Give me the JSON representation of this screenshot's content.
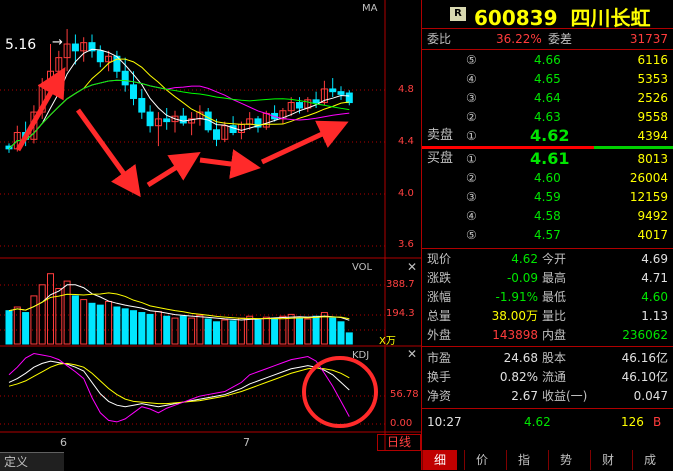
{
  "chart": {
    "indicator_ma": "MA",
    "price_label": "5.16",
    "price_axis": [
      "4.8",
      "4.4",
      "4.0",
      "3.6"
    ],
    "vol_title": "VOL",
    "vol_axis": [
      "388.7",
      "194.3"
    ],
    "vol_unit": "X万",
    "kdj_title": "KDJ",
    "kdj_axis": [
      "56.78",
      "0.00"
    ],
    "x_labels": [
      "6",
      "7"
    ],
    "period_tab": "日线",
    "left_tab": "定义"
  },
  "colors": {
    "up": "#ff3c3c",
    "down": "#00e6ff",
    "grid": "#b00000",
    "ma5": "#ffffff",
    "ma10": "#ffff00",
    "ma20": "#ff00ff",
    "ma30": "#00ff00",
    "annotation": "#ff2a2a"
  },
  "quote": {
    "code": "600839",
    "name": "四川长虹",
    "badge": "R",
    "weibi_label": "委比",
    "weibi_value": "36.22%",
    "weicha_label": "委差",
    "weicha_value": "31737",
    "asks": [
      {
        "label": "⑤",
        "price": "4.66",
        "volume": "6116"
      },
      {
        "label": "④",
        "price": "4.65",
        "volume": "5353"
      },
      {
        "label": "③",
        "price": "4.64",
        "volume": "2526"
      },
      {
        "label": "②",
        "price": "4.63",
        "volume": "9558"
      },
      {
        "label": "①",
        "price": "4.62",
        "volume": "4394"
      }
    ],
    "ask_section": "卖盘",
    "bid_section": "买盘",
    "bids": [
      {
        "label": "①",
        "price": "4.61",
        "volume": "8013"
      },
      {
        "label": "②",
        "price": "4.60",
        "volume": "26004"
      },
      {
        "label": "③",
        "price": "4.59",
        "volume": "12159"
      },
      {
        "label": "④",
        "price": "4.58",
        "volume": "9492"
      },
      {
        "label": "⑤",
        "price": "4.57",
        "volume": "4017"
      }
    ],
    "stats": [
      {
        "l1": "现价",
        "v1": "4.62",
        "l2": "今开",
        "v2": "4.69"
      },
      {
        "l1": "涨跌",
        "v1": "-0.09",
        "l2": "最高",
        "v2": "4.71"
      },
      {
        "l1": "涨幅",
        "v1": "-1.91%",
        "l2": "最低",
        "v2": "4.60"
      },
      {
        "l1": "总量",
        "v1": "38.00万",
        "l2": "量比",
        "v2": "1.13"
      },
      {
        "l1": "外盘",
        "v1": "143898",
        "l2": "内盘",
        "v2": "236062"
      }
    ],
    "fund": [
      {
        "l1": "市盈",
        "v1": "24.68",
        "l2": "股本",
        "v2": "46.16亿"
      },
      {
        "l1": "换手",
        "v1": "0.82%",
        "l2": "流通",
        "v2": "46.10亿"
      },
      {
        "l1": "净资",
        "v1": "2.67",
        "l2": "收益(一)",
        "v2": "0.047"
      }
    ],
    "tick": {
      "time": "10:27",
      "price": "4.62",
      "volume": "126",
      "side": "B"
    },
    "tabs": [
      "细",
      "价",
      "指",
      "势",
      "财",
      "成"
    ]
  },
  "chart_data": {
    "type": "candlestick",
    "price_ylim": [
      3.5,
      5.3
    ],
    "candles": [
      [
        4.3,
        4.32,
        4.25,
        4.28
      ],
      [
        4.28,
        4.45,
        4.26,
        4.4
      ],
      [
        4.4,
        4.48,
        4.3,
        4.35
      ],
      [
        4.35,
        4.6,
        4.32,
        4.55
      ],
      [
        4.55,
        4.8,
        4.5,
        4.75
      ],
      [
        4.75,
        5.05,
        4.7,
        4.85
      ],
      [
        4.85,
        5.0,
        4.78,
        4.95
      ],
      [
        4.95,
        5.16,
        4.85,
        5.05
      ],
      [
        5.05,
        5.12,
        4.9,
        5.0
      ],
      [
        5.0,
        5.1,
        4.92,
        5.06
      ],
      [
        5.06,
        5.12,
        4.95,
        5.0
      ],
      [
        5.0,
        5.04,
        4.88,
        4.92
      ],
      [
        4.92,
        5.0,
        4.85,
        4.96
      ],
      [
        4.96,
        5.0,
        4.8,
        4.85
      ],
      [
        4.85,
        4.95,
        4.7,
        4.75
      ],
      [
        4.75,
        4.85,
        4.6,
        4.65
      ],
      [
        4.65,
        4.72,
        4.5,
        4.55
      ],
      [
        4.55,
        4.6,
        4.4,
        4.45
      ],
      [
        4.45,
        4.55,
        4.3,
        4.5
      ],
      [
        4.5,
        4.58,
        4.42,
        4.48
      ],
      [
        4.48,
        4.56,
        4.4,
        4.52
      ],
      [
        4.52,
        4.58,
        4.45,
        4.47
      ],
      [
        4.47,
        4.55,
        4.38,
        4.5
      ],
      [
        4.5,
        4.6,
        4.45,
        4.55
      ],
      [
        4.55,
        4.58,
        4.4,
        4.42
      ],
      [
        4.42,
        4.5,
        4.3,
        4.35
      ],
      [
        4.35,
        4.48,
        4.33,
        4.45
      ],
      [
        4.45,
        4.52,
        4.38,
        4.4
      ],
      [
        4.4,
        4.48,
        4.35,
        4.46
      ],
      [
        4.46,
        4.55,
        4.42,
        4.5
      ],
      [
        4.5,
        4.52,
        4.4,
        4.44
      ],
      [
        4.44,
        4.56,
        4.42,
        4.54
      ],
      [
        4.54,
        4.6,
        4.48,
        4.5
      ],
      [
        4.5,
        4.58,
        4.46,
        4.56
      ],
      [
        4.56,
        4.66,
        4.52,
        4.62
      ],
      [
        4.62,
        4.66,
        4.54,
        4.58
      ],
      [
        4.58,
        4.66,
        4.55,
        4.64
      ],
      [
        4.64,
        4.7,
        4.58,
        4.62
      ],
      [
        4.62,
        4.78,
        4.6,
        4.72
      ],
      [
        4.72,
        4.8,
        4.66,
        4.7
      ],
      [
        4.7,
        4.74,
        4.64,
        4.68
      ],
      [
        4.69,
        4.71,
        4.6,
        4.62
      ]
    ],
    "volumes": [
      180,
      200,
      170,
      260,
      320,
      380,
      300,
      340,
      260,
      240,
      220,
      210,
      230,
      200,
      190,
      180,
      170,
      160,
      175,
      150,
      140,
      150,
      140,
      155,
      135,
      120,
      130,
      125,
      140,
      150,
      130,
      145,
      140,
      150,
      160,
      140,
      135,
      150,
      170,
      140,
      120,
      60
    ],
    "kdj": {
      "k": [
        60,
        65,
        72,
        80,
        85,
        88,
        86,
        84,
        80,
        75,
        60,
        45,
        35,
        30,
        28,
        30,
        32,
        30,
        28,
        30,
        32,
        34,
        36,
        38,
        40,
        42,
        44,
        48,
        52,
        58,
        62,
        66,
        70,
        74,
        78,
        80,
        82,
        80,
        76,
        70,
        60,
        50
      ],
      "d": [
        55,
        58,
        62,
        68,
        74,
        80,
        84,
        85,
        83,
        80,
        72,
        62,
        52,
        44,
        38,
        35,
        34,
        33,
        32,
        32,
        33,
        34,
        35,
        36,
        38,
        40,
        42,
        45,
        48,
        52,
        56,
        60,
        64,
        68,
        72,
        75,
        78,
        79,
        78,
        76,
        72,
        66
      ],
      "j": [
        70,
        80,
        92,
        98,
        96,
        94,
        90,
        82,
        74,
        65,
        40,
        20,
        10,
        8,
        12,
        20,
        28,
        25,
        20,
        26,
        30,
        34,
        38,
        42,
        44,
        46,
        48,
        54,
        60,
        70,
        74,
        78,
        82,
        86,
        90,
        92,
        94,
        88,
        72,
        55,
        35,
        15
      ]
    }
  }
}
